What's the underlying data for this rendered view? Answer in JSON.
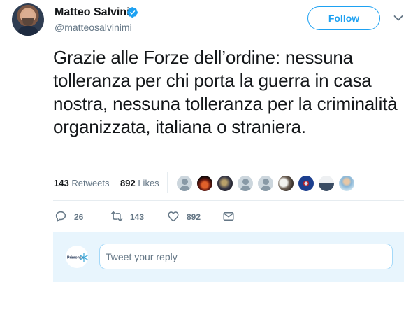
{
  "author": {
    "name": "Matteo Salvini",
    "handle": "@matteosalvinimi",
    "verified": true
  },
  "follow_label": "Follow",
  "tweet": {
    "text": "Grazie alle Forze dell’ordine: nessuna tolleranza per chi porta la guerra in casa nostra, nessuna tolleranza per la criminalità organizzata, italiana o straniera."
  },
  "stats": {
    "retweets_count": "143",
    "retweets_label": "Retweets",
    "likes_count": "892",
    "likes_label": "Likes"
  },
  "likers": [
    {
      "type": "default"
    },
    {
      "type": "fire"
    },
    {
      "type": "crowd"
    },
    {
      "type": "default"
    },
    {
      "type": "default"
    },
    {
      "type": "eagle"
    },
    {
      "type": "emblem"
    },
    {
      "type": "figure"
    },
    {
      "type": "woman"
    }
  ],
  "actions": {
    "reply_count": "26",
    "retweet_count": "143",
    "like_count": "892"
  },
  "reply": {
    "placeholder": "Tweet your reply",
    "avatar_text": "Primonsk"
  },
  "colors": {
    "accent": "#1da1f2",
    "secondary_text": "#657786",
    "reply_bg": "#e8f5fd"
  }
}
